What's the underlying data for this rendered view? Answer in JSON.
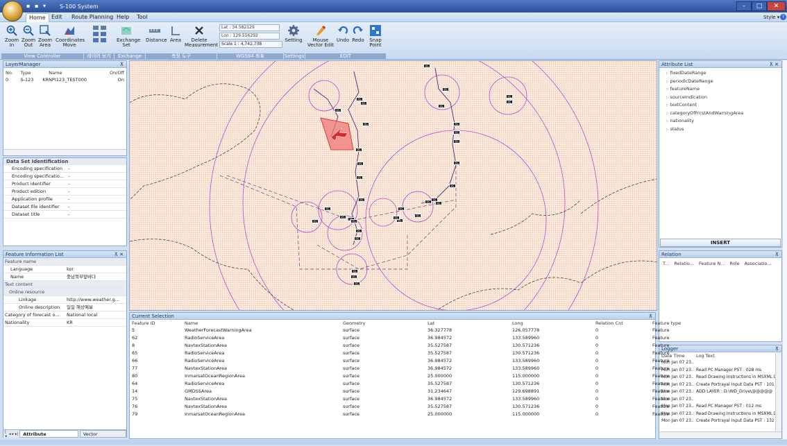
{
  "app": {
    "title": "S-100 System",
    "style_label": "Style ▾",
    "help_icon": "?"
  },
  "menu": {
    "items": [
      "Home",
      "Edit",
      "Route Planning",
      "Help",
      "Tool"
    ]
  },
  "ribbon": {
    "buttons": [
      {
        "label": "Zoom\nIn",
        "icon": "zoom-in-icon"
      },
      {
        "label": "Zoom\nOut",
        "icon": "zoom-out-icon"
      },
      {
        "label": "Zoom\nArea",
        "icon": "zoom-area-icon"
      },
      {
        "label": "Coordinates\nMove",
        "icon": "coordinates-move-icon"
      },
      {
        "label": "Exchange\nSet",
        "icon": "exchange-set-icon"
      },
      {
        "label": "Distance",
        "icon": "distance-icon"
      },
      {
        "label": "Area",
        "icon": "area-icon"
      },
      {
        "label": "Delete\nMeasurement",
        "icon": "delete-icon"
      },
      {
        "label": "Setting",
        "icon": "gear-icon"
      },
      {
        "label": "Mouse\nVector Edit",
        "icon": "vector-edit-icon"
      },
      {
        "label": "Undo",
        "icon": "undo-icon"
      },
      {
        "label": "Redo",
        "icon": "redo-icon"
      },
      {
        "label": "Snap\nPoint",
        "icon": "snap-point-icon"
      }
    ],
    "lat": "Lat : 34.582129",
    "lon": "Lon : 129.556292",
    "scale": "Scale 1 : 4,742,738",
    "groups": [
      "View Controller",
      "레이어 보기",
      "Exchange Set",
      "측정 도구",
      "WGS84 좌표",
      "Settings",
      "EDIT"
    ]
  },
  "layer_manager": {
    "title": "LayerManager",
    "columns": [
      "No.",
      "Type",
      "Name",
      "On/Off"
    ],
    "rows": [
      [
        "0",
        "S-123",
        "KRNPI123_TEST000",
        "On"
      ]
    ]
  },
  "dataset": {
    "title": "Data Set Identification",
    "rows": [
      [
        "Encoding specification",
        "-"
      ],
      [
        "Encoding specificatio...",
        "-"
      ],
      [
        "Product identifier",
        "-"
      ],
      [
        "Product edition",
        "-"
      ],
      [
        "Application profile",
        "-"
      ],
      [
        "Dataset file identifier",
        "-"
      ],
      [
        "Dataset title",
        "-"
      ]
    ]
  },
  "feature_info": {
    "title": "Feature Information List",
    "rows": [
      {
        "k": "Feature name",
        "v": "",
        "cat": 1
      },
      {
        "k": "Language",
        "v": "kor",
        "cat": 0
      },
      {
        "k": "Name",
        "v": "충남북부앞바다",
        "cat": 0
      },
      {
        "k": "Text content",
        "v": "",
        "cat": 1
      },
      {
        "k": "Online resource",
        "v": "",
        "cat": 1
      },
      {
        "k": "Linkage",
        "v": "http://www.weather.g...",
        "cat": 0
      },
      {
        "k": "Online description",
        "v": "일일 해상예보",
        "cat": 0
      },
      {
        "k": "Category of forecast o...",
        "v": "National local",
        "cat": 0
      },
      {
        "k": "Nationality",
        "v": "KR",
        "cat": 0
      }
    ],
    "tabs": [
      "Attribute Information",
      "Vector Information"
    ],
    "nav": [
      "|◂",
      "◂",
      "▸",
      "▸|"
    ]
  },
  "attribute_list": {
    "title": "Attribute List",
    "items": [
      "fixedDateRange",
      "periodicDateRange",
      "featureName",
      "sourceIndication",
      "textContent",
      "categoryOfFrcstAndWarningArea",
      "nationality",
      "status"
    ],
    "insert": "INSERT"
  },
  "relation": {
    "title": "Relation",
    "columns": [
      "T...",
      "Relatio...",
      "Feature N...",
      "Role",
      "Associatio..."
    ]
  },
  "logger": {
    "title": "Logger",
    "columns": [
      "Date Time",
      "Log Text"
    ],
    "rows": [
      [
        "Mon Jan 07 23...",
        ""
      ],
      [
        "Mon Jan 07 23...",
        "Read PC Manager PST : 028 ms"
      ],
      [
        "Mon Jan 07 23...",
        "Read Drawing Instructions in MSXML D"
      ],
      [
        "Mon Jan 07 23...",
        "Create Portrayal Input Data PST : 101"
      ],
      [
        "Mon Jan 07 23...",
        "ADD LAYER : D:\\WD_Drive\\@@@@@"
      ],
      [
        "Mon Jan 07 23...",
        ""
      ],
      [
        "Mon Jan 07 23...",
        "Read PC Manager PST : 012 ms"
      ],
      [
        "Mon Jan 07 23...",
        "Read Drawing Instructions in MSXML D"
      ],
      [
        "Mon Jan 07 23...",
        "Create Portrayal Input Data PST : 132"
      ]
    ]
  },
  "selection": {
    "title": "Current Selection",
    "columns": [
      "Feature ID",
      "Name",
      "Geometry",
      "Lat",
      "Long",
      "Relation Cnt",
      "Feature type"
    ],
    "rows": [
      [
        "5",
        "WeatherForecastWarningArea",
        "surface",
        "36.327778",
        "126.057778",
        "0",
        "Feature"
      ],
      [
        "62",
        "RadioServiceArea",
        "surface",
        "36.984572",
        "133.589960",
        "0",
        "Feature"
      ],
      [
        "8",
        "NavtexStationArea",
        "surface",
        "35.527587",
        "130.571236",
        "0",
        "Feature"
      ],
      [
        "65",
        "RadioServiceArea",
        "surface",
        "35.527587",
        "130.571236",
        "0",
        "Feature"
      ],
      [
        "66",
        "RadioServiceArea",
        "surface",
        "36.984572",
        "133.589960",
        "0",
        "Feature"
      ],
      [
        "77",
        "NavtexStationArea",
        "surface",
        "36.984572",
        "133.589960",
        "0",
        "Feature"
      ],
      [
        "80",
        "InmarsatOceanRegionArea",
        "surface",
        "25.000000",
        "115.000000",
        "0",
        "Feature"
      ],
      [
        "64",
        "RadioServiceArea",
        "surface",
        "35.527587",
        "130.571236",
        "0",
        "Feature"
      ],
      [
        "14",
        "GMDSSArea",
        "surface",
        "31.234647",
        "129.698891",
        "0",
        "Feature"
      ],
      [
        "75",
        "NavtexStationArea",
        "surface",
        "36.984572",
        "133.589960",
        "0",
        "Feature"
      ],
      [
        "76",
        "NavtexStationArea",
        "surface",
        "35.527587",
        "130.571236",
        "0",
        "Feature"
      ],
      [
        "79",
        "InmarsatOceanRegionArea",
        "surface",
        "25.000000",
        "115.000000",
        "0",
        "Feature"
      ]
    ]
  },
  "map": {
    "marker": "RS"
  }
}
